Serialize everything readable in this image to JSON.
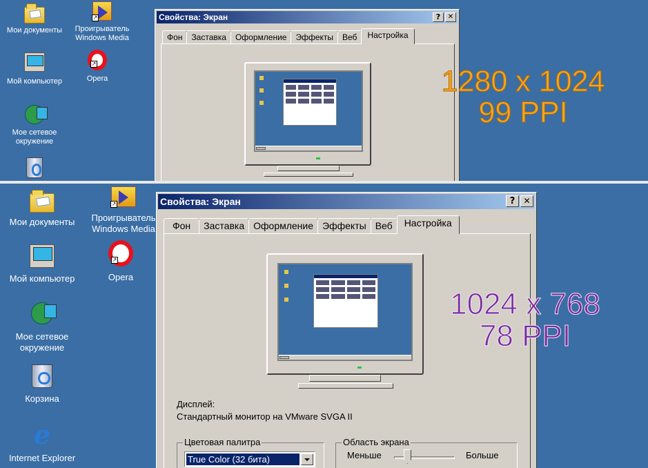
{
  "top": {
    "desktop_icons": [
      {
        "label": "Мои документы",
        "icon": "my-documents-icon"
      },
      {
        "label": "Проигрыватель Windows Media",
        "icon": "windows-media-player-icon"
      },
      {
        "label": "Мой компьютер",
        "icon": "my-computer-icon"
      },
      {
        "label": "Opera",
        "icon": "opera-icon"
      },
      {
        "label": "Мое сетевое окружение",
        "icon": "network-places-icon"
      },
      {
        "label": "",
        "icon": "recycle-bin-icon"
      }
    ],
    "dialog": {
      "title": "Свойства: Экран",
      "help_button": "?",
      "close_button": "✕",
      "tabs": [
        "Фон",
        "Заставка",
        "Оформление",
        "Эффекты",
        "Веб",
        "Настройка"
      ],
      "active_tab": "Настройка"
    },
    "overlay": {
      "resolution": "1280 x 1024",
      "ppi": "99 PPI",
      "color": "#f5a623"
    }
  },
  "bottom": {
    "desktop_icons": [
      {
        "label": "Мои документы",
        "icon": "my-documents-icon"
      },
      {
        "label": "Проигрыватель Windows Media",
        "icon": "windows-media-player-icon"
      },
      {
        "label": "Мой компьютер",
        "icon": "my-computer-icon"
      },
      {
        "label": "Opera",
        "icon": "opera-icon"
      },
      {
        "label": "Мое сетевое окружение",
        "icon": "network-places-icon"
      },
      {
        "label": "Корзина",
        "icon": "recycle-bin-icon"
      },
      {
        "label": "Internet Explorer",
        "icon": "internet-explorer-icon"
      }
    ],
    "dialog": {
      "title": "Свойства: Экран",
      "help_button": "?",
      "close_button": "✕",
      "tabs": [
        "Фон",
        "Заставка",
        "Оформление",
        "Эффекты",
        "Веб",
        "Настройка"
      ],
      "active_tab": "Настройка",
      "display_label": "Дисплей:",
      "display_value": "Стандартный монитор на VMware SVGA II",
      "color_palette": {
        "label": "Цветовая палитра",
        "selected": "True Color (32 бита)"
      },
      "screen_area": {
        "label": "Область экрана",
        "less": "Меньше",
        "more": "Больше"
      }
    },
    "overlay": {
      "resolution": "1024 x 768",
      "ppi": "78 PPI",
      "color": "#7b2d9e"
    }
  }
}
